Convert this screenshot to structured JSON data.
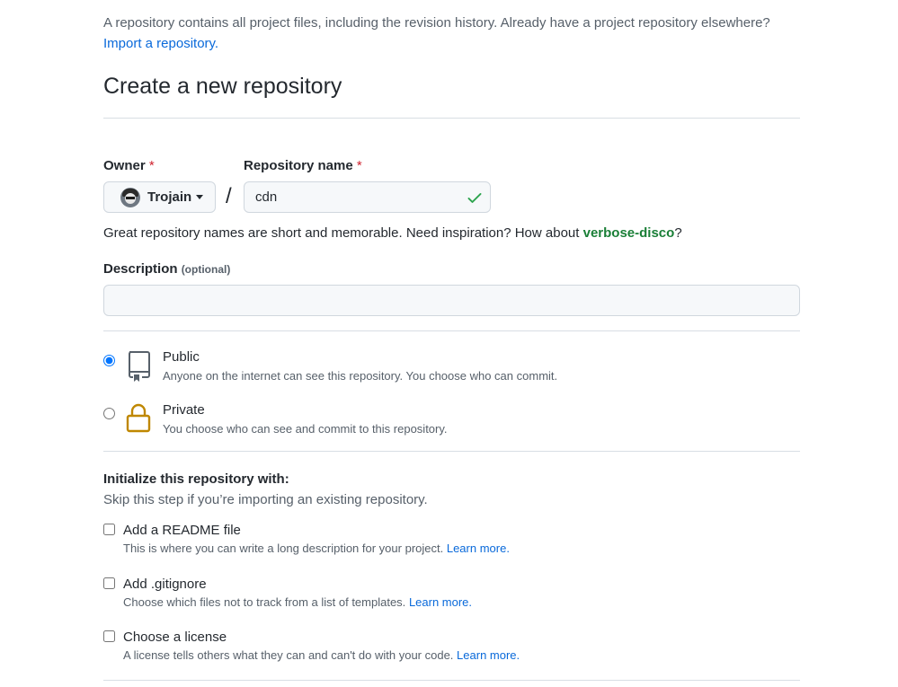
{
  "intro": {
    "text": "A repository contains all project files, including the revision history. Already have a project repository elsewhere?",
    "import_link": "Import a repository."
  },
  "page_title": "Create a new repository",
  "owner": {
    "label": "Owner",
    "required_mark": "*",
    "selected": "Trojain",
    "avatar_icon": "user-avatar"
  },
  "separator": "/",
  "repo_name": {
    "label": "Repository name",
    "required_mark": "*",
    "value": "cdn",
    "valid": true,
    "valid_icon": "check-icon"
  },
  "name_hint": {
    "text": "Great repository names are short and memorable. Need inspiration? How about ",
    "suggestion": "verbose-disco",
    "suffix": "?"
  },
  "description": {
    "label": "Description",
    "optional": "(optional)",
    "value": "",
    "placeholder": ""
  },
  "visibility": {
    "selected": "public",
    "options": [
      {
        "id": "public",
        "title": "Public",
        "desc": "Anyone on the internet can see this repository. You choose who can commit.",
        "icon": "repo-icon",
        "checked": true
      },
      {
        "id": "private",
        "title": "Private",
        "desc": "You choose who can see and commit to this repository.",
        "icon": "lock-icon",
        "checked": false
      }
    ]
  },
  "init": {
    "heading": "Initialize this repository with:",
    "subtext": "Skip this step if you’re importing an existing repository.",
    "options": [
      {
        "title": "Add a README file",
        "desc": "This is where you can write a long description for your project.",
        "link": "Learn more.",
        "checked": false
      },
      {
        "title": "Add .gitignore",
        "desc": "Choose which files not to track from a list of templates.",
        "link": "Learn more.",
        "checked": false
      },
      {
        "title": "Choose a license",
        "desc": "A license tells others what they can and can't do with your code.",
        "link": "Learn more.",
        "checked": false
      }
    ]
  },
  "colors": {
    "link": "#0969da",
    "success": "#1a7f37",
    "check": "#2da44e",
    "required": "#cf222e",
    "lock": "#bf8700",
    "muted": "#57606a"
  }
}
